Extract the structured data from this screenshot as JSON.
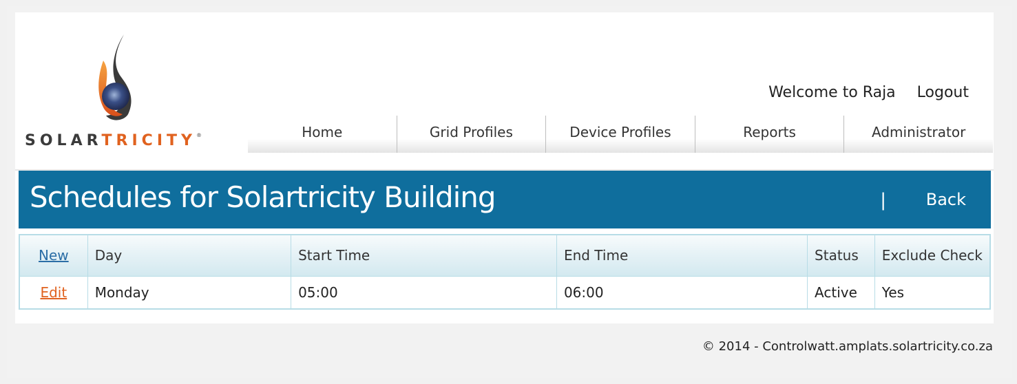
{
  "brand": {
    "solar": "SOLAR",
    "tricity": "TRICITY",
    "tm": "®"
  },
  "header": {
    "welcome": "Welcome to Raja",
    "logout": "Logout"
  },
  "nav": [
    "Home",
    "Grid Profiles",
    "Device Profiles",
    "Reports",
    "Administrator"
  ],
  "titlebar": {
    "title": "Schedules for Solartricity Building",
    "separator": "|",
    "back": "Back"
  },
  "table": {
    "new_label": "New",
    "columns": [
      "Day",
      "Start Time",
      "End Time",
      "Status",
      "Exclude Check"
    ],
    "rows": [
      {
        "action": "Edit",
        "day": "Monday",
        "start": "05:00",
        "end": "06:00",
        "status": "Active",
        "exclude": "Yes"
      }
    ]
  },
  "footer": "© 2014 - Controlwatt.amplats.solartricity.co.za",
  "colors": {
    "title_bar": "#0f6e9d",
    "brand_orange": "#e0621f",
    "link_blue": "#2b6ea6",
    "table_border": "#b7dce6"
  }
}
